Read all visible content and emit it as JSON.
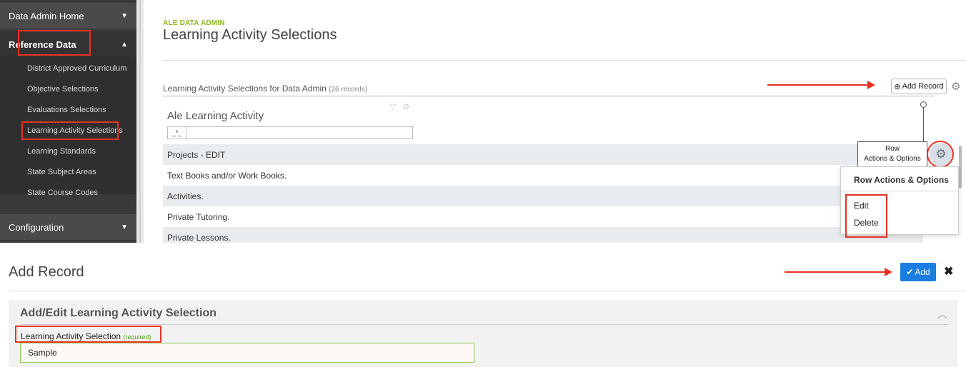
{
  "sidebar": {
    "data_admin_home": "Data Admin Home",
    "reference_data": "Reference Data",
    "items": [
      "District Approved Curriculum",
      "Objective Selections",
      "Evaluations Selections",
      "Learning Activity Selections",
      "Learning Standards",
      "State Subject Areas",
      "State Course Codes"
    ],
    "configuration": "Configuration"
  },
  "header": {
    "eyebrow": "ALE DATA ADMIN",
    "title": "Learning Activity Selections"
  },
  "list": {
    "title": "Learning Activity Selections for Data Admin",
    "record_count": "(26 records)",
    "add_record_label": "Add Record",
    "column_header": "Ale Learning Activity",
    "filter_operator": "_*_",
    "rows": [
      "Projects - EDIT",
      "Text Books and/or Work Books.",
      "Activities.",
      "Private Tutoring.",
      "Private Lessons."
    ]
  },
  "row_actions": {
    "tooltip_line1": "Row",
    "tooltip_line2": "Actions & Options",
    "menu_title": "Row Actions & Options",
    "edit": "Edit",
    "delete": "Delete"
  },
  "add_record_panel": {
    "title": "Add Record",
    "add_button": "Add",
    "section_title": "Add/Edit Learning Activity Selection",
    "field_label": "Learning Activity Selection",
    "field_required": "(required)",
    "field_value": "Sample"
  },
  "colors": {
    "annotation_red": "#e63323",
    "eyebrow_green": "#8ab820",
    "primary_blue": "#1a7de0"
  }
}
